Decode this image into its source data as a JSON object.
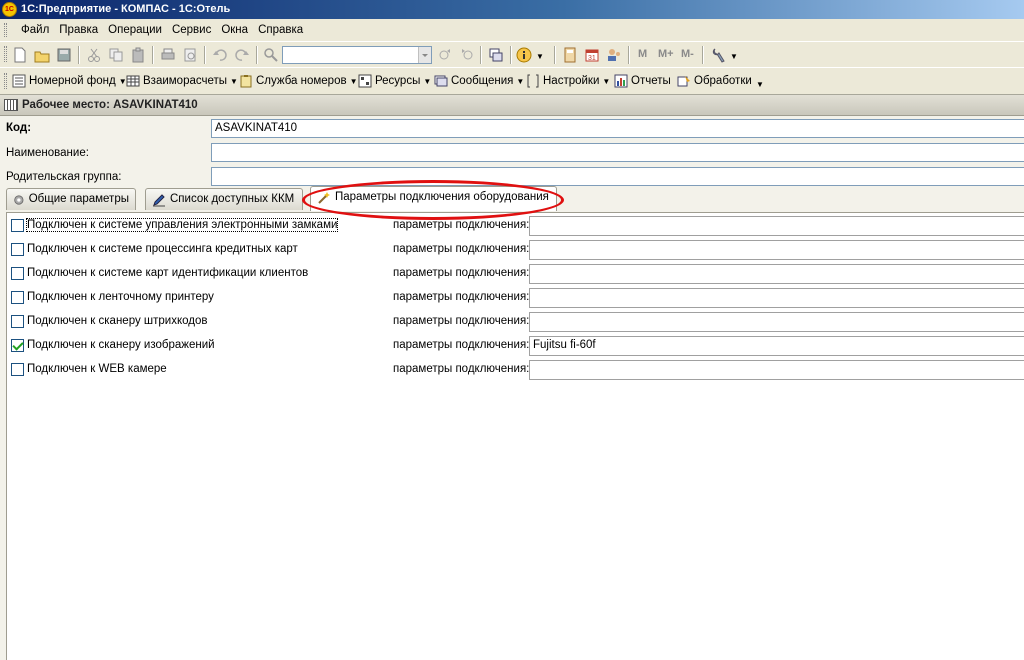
{
  "window": {
    "title": "1С:Предприятие - КОМПАС - 1С:Отель",
    "logo": "1С"
  },
  "menu": [
    "Файл",
    "Правка",
    "Операции",
    "Сервис",
    "Окна",
    "Справка"
  ],
  "toolbar1": {
    "icons": [
      "new-doc-icon",
      "open-folder-icon",
      "save-icon",
      "cut-icon",
      "copy-icon",
      "paste-icon",
      "print-icon",
      "preview-icon",
      "undo-icon",
      "redo-icon",
      "find-icon",
      "search-next-icon",
      "search-prev-icon",
      "windows-icon",
      "info-icon",
      "calculator-icon",
      "calendar-icon",
      "users-icon",
      "tools-icon"
    ],
    "search_value": "",
    "memory_buttons": [
      "M",
      "M+",
      "M-"
    ]
  },
  "toolbar2": [
    {
      "label": "Номерной фонд",
      "dropdown": true,
      "icon": "checklist-icon"
    },
    {
      "label": "Взаиморасчеты",
      "dropdown": true,
      "icon": "grid-icon"
    },
    {
      "label": "Служба номеров",
      "dropdown": true,
      "icon": "clipboard-icon"
    },
    {
      "label": "Ресурсы",
      "dropdown": true,
      "icon": "resources-icon"
    },
    {
      "label": "Сообщения",
      "dropdown": true,
      "icon": "messages-icon"
    },
    {
      "label": "Настройки",
      "dropdown": true,
      "icon": "bracket-icon"
    },
    {
      "label": "Отчеты",
      "dropdown": false,
      "icon": "report-icon"
    },
    {
      "label": "Обработки",
      "dropdown": false,
      "icon": "processing-icon"
    }
  ],
  "form": {
    "title": "Рабочее место: ASAVKINAT410",
    "fields": {
      "code": {
        "label": "Код:",
        "value": "ASAVKINAT410"
      },
      "name": {
        "label": "Наименование:",
        "value": ""
      },
      "parent": {
        "label": "Родительская группа:",
        "value": ""
      }
    },
    "tabs": [
      {
        "label": "Общие параметры",
        "icon": "gear-icon",
        "active": false
      },
      {
        "label": "Список доступных ККМ",
        "icon": "pencil-list-icon",
        "active": false
      },
      {
        "label": "Параметры подключения оборудования",
        "icon": "wand-icon",
        "active": true
      }
    ],
    "param_label": "параметры подключения:",
    "equipment": [
      {
        "label": "Подключен к системе управления электронными замками",
        "checked": false,
        "params": ""
      },
      {
        "label": "Подключен к системе процессинга кредитных карт",
        "checked": false,
        "params": ""
      },
      {
        "label": "Подключен к системе карт идентификации клиентов",
        "checked": false,
        "params": ""
      },
      {
        "label": "Подключен к ленточному принтеру",
        "checked": false,
        "params": ""
      },
      {
        "label": "Подключен к сканеру штрихкодов",
        "checked": false,
        "params": ""
      },
      {
        "label": "Подключен к сканеру изображений",
        "checked": true,
        "params": "Fujitsu fi-60f"
      },
      {
        "label": "Подключен к WEB камере",
        "checked": false,
        "params": ""
      }
    ]
  },
  "annotation": {
    "color": "#e01010",
    "shape": "oval-highlight"
  }
}
